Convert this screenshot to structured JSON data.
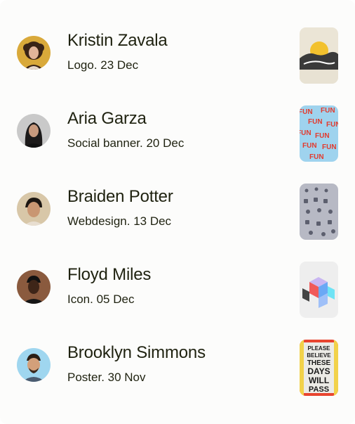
{
  "activity": {
    "items": [
      {
        "name": "Kristin Zavala",
        "meta": "Logo. 23 Dec",
        "avatar_icon": "avatar-portrait",
        "thumb_icon": "logo-thumbnail"
      },
      {
        "name": "Aria Garza",
        "meta": "Social banner. 20 Dec",
        "avatar_icon": "avatar-portrait",
        "thumb_icon": "social-banner-thumbnail"
      },
      {
        "name": "Braiden Potter",
        "meta": "Webdesign. 13 Dec",
        "avatar_icon": "avatar-portrait",
        "thumb_icon": "webdesign-thumbnail"
      },
      {
        "name": "Floyd Miles",
        "meta": "Icon. 05 Dec",
        "avatar_icon": "avatar-portrait",
        "thumb_icon": "icon-thumbnail"
      },
      {
        "name": "Brooklyn Simmons",
        "meta": "Poster. 30 Nov",
        "avatar_icon": "avatar-portrait",
        "thumb_icon": "poster-thumbnail"
      }
    ],
    "thumb_texts": {
      "social_banner": "FUN",
      "poster_lines": [
        "PLEASE",
        "BELIEVE",
        "THESE",
        "DAYS",
        "WILL",
        "PASS"
      ]
    }
  },
  "colors": {
    "text": "#1f2210",
    "background": "#fcfcfb"
  }
}
